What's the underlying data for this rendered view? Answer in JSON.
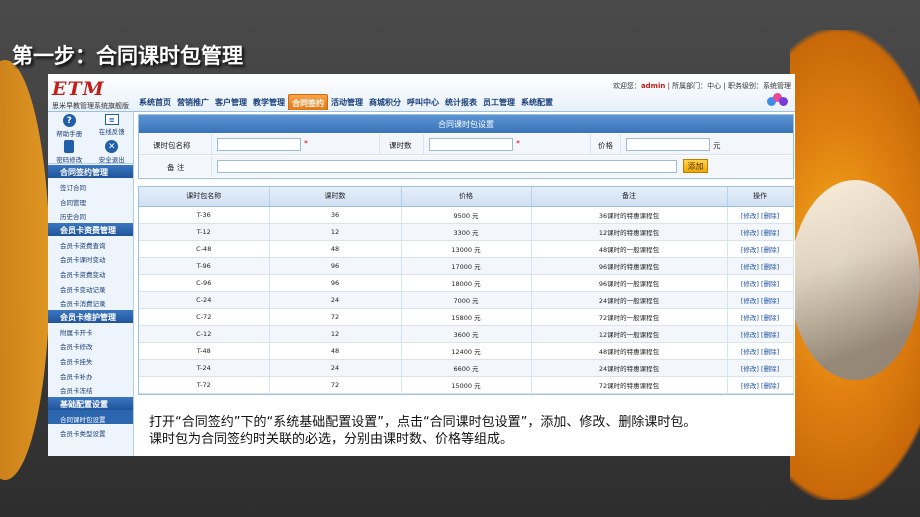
{
  "slide": {
    "title": "第一步：合同课时包管理",
    "caption_line1": "打开“合同签约”下的“系统基础配置设置”，点击“合同课时包设置”，添加、修改、删除课时包。",
    "caption_line2": "课时包为合同签约时关联的必选，分别由课时数、价格等组成。"
  },
  "app": {
    "logo": "ETM",
    "logo_subtitle": "思米早教管理系统旗舰版",
    "nav": [
      "系统首页",
      "营销推广",
      "客户管理",
      "教学管理",
      "合同签约",
      "活动管理",
      "商城积分",
      "呼叫中心",
      "统计报表",
      "员工管理",
      "系统配置"
    ],
    "nav_active_index": 4,
    "userinfo": {
      "welcome": "欢迎您：",
      "username": "admin",
      "dept": "| 所属部门：中心 | 职务级别：系统管理"
    }
  },
  "sidebar": {
    "quick": [
      {
        "label": "帮助手册",
        "icon": "help-icon"
      },
      {
        "label": "在线反馈",
        "icon": "feedback-icon"
      },
      {
        "label": "密码修改",
        "icon": "lock-icon"
      },
      {
        "label": "安全退出",
        "icon": "exit-icon"
      }
    ],
    "sections": [
      {
        "title": "合同签约管理",
        "items": [
          "签订合同",
          "合同管理",
          "历史合同"
        ]
      },
      {
        "title": "会员卡资费管理",
        "items": [
          "会员卡资费查询",
          "会员卡课时变动",
          "会员卡资费变动",
          "会员卡变动记录",
          "会员卡消费记录"
        ]
      },
      {
        "title": "会员卡维护管理",
        "items": [
          "附属卡开卡",
          "会员卡修改",
          "会员卡挂失",
          "会员卡补办",
          "会员卡冻结"
        ]
      },
      {
        "title": "基础配置设置",
        "items": [
          "合同课时包设置",
          "会员卡类型设置"
        ]
      }
    ],
    "active_item": "合同课时包设置"
  },
  "form": {
    "header": "合同课时包设置",
    "name_label": "课时包名称",
    "hours_label": "课时数",
    "price_label": "价格",
    "price_unit": "元",
    "required_mark": "*",
    "remark_label": "备 注",
    "add_button": "添加"
  },
  "table": {
    "columns": [
      "课时包名称",
      "课时数",
      "价格",
      "备注",
      "操作"
    ],
    "rows": [
      [
        "T-36",
        "36",
        "9500 元",
        "36课时的特惠课程包",
        "[修改] [删除]"
      ],
      [
        "T-12",
        "12",
        "3300 元",
        "12课时的特惠课程包",
        "[修改] [删除]"
      ],
      [
        "C-48",
        "48",
        "13000 元",
        "48课时的一般课程包",
        "[修改] [删除]"
      ],
      [
        "T-96",
        "96",
        "17000 元",
        "96课时的特惠课程包",
        "[修改] [删除]"
      ],
      [
        "C-96",
        "96",
        "18000 元",
        "96课时的一般课程包",
        "[修改] [删除]"
      ],
      [
        "C-24",
        "24",
        "7000 元",
        "24课时的一般课程包",
        "[修改] [删除]"
      ],
      [
        "C-72",
        "72",
        "15800 元",
        "72课时的一般课程包",
        "[修改] [删除]"
      ],
      [
        "C-12",
        "12",
        "3600 元",
        "12课时的一般课程包",
        "[修改] [删除]"
      ],
      [
        "T-48",
        "48",
        "12400 元",
        "48课时的特惠课程包",
        "[修改] [删除]"
      ],
      [
        "T-24",
        "24",
        "6600 元",
        "24课时的特惠课程包",
        "[修改] [删除]"
      ],
      [
        "T-72",
        "72",
        "15000 元",
        "72课时的特惠课程包",
        "[修改] [删除]"
      ]
    ]
  },
  "colors": {
    "accent_orange": "#e47812",
    "header_blue": "#3a74b8",
    "link_blue": "#1a50a0"
  }
}
